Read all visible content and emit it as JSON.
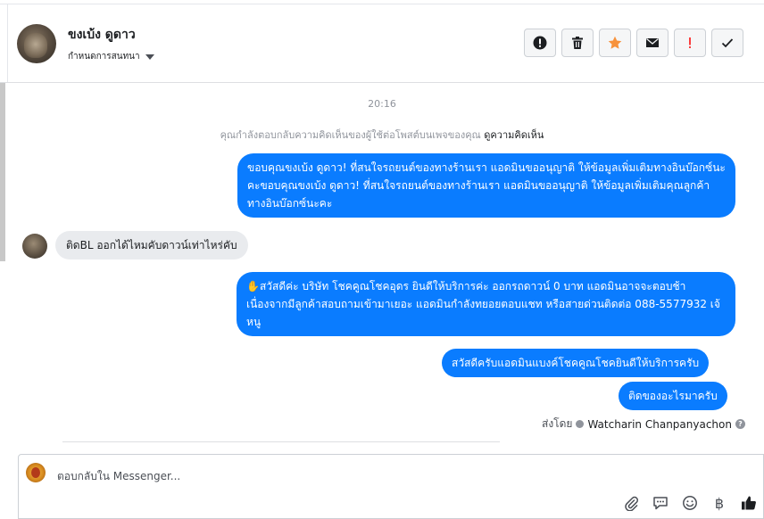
{
  "header": {
    "contact_name": "ขงเบ้ง ดูดาว",
    "assign_label": "กำหนดการสนทนา",
    "actions": [
      {
        "name": "spam-button",
        "icon": "exclamation-circle-icon"
      },
      {
        "name": "delete-button",
        "icon": "trash-icon"
      },
      {
        "name": "star-button",
        "icon": "star-icon"
      },
      {
        "name": "mark-unread-button",
        "icon": "envelope-icon"
      },
      {
        "name": "follow-up-button",
        "icon": "exclamation-icon"
      },
      {
        "name": "done-button",
        "icon": "check-icon"
      }
    ],
    "colors": {
      "star": "#f7923b",
      "flag": "#fa3e3e"
    }
  },
  "conversation": {
    "timestamp": "20:16",
    "notice_text": "คุณกำลังตอบกลับความคิดเห็นของผู้ใช้ต่อโพสต์บนเพจของคุณ",
    "notice_link": "ดูความคิดเห็น",
    "messages": [
      {
        "direction": "out",
        "text": "ขอบคุณขงเบ้ง ดูดาว! ที่สนใจรถยนต์ของทางร้านเรา แอดมินขออนุญาติ ให้ข้อมูลเพิ่มเติมทางอินบ๊อกซ์นะคะขอบคุณขงเบ้ง ดูดาว! ที่สนใจรถยนต์ของทางร้านเรา แอดมินขออนุญาติ ให้ข้อมูลเพิ่มเติมคุณลูกค้า ทางอินบ๊อกซ์นะคะ"
      },
      {
        "direction": "in",
        "text": "ติดBL ออกได้ไหมคับดาวน์เท่าไหร่คับ"
      },
      {
        "direction": "out",
        "emoji": "✋",
        "text": "สวัสดีค่ะ บริษัท โชคคูณโชคอุดร ยินดีให้บริการค่ะ ออกรถดาวน์ 0 บาท แอดมินอาจจะตอบช้าเนื่องจากมีลูกค้าสอบถามเข้ามาเยอะ แอดมินกำลังทยอยตอบแชท หรือสายด่วนติดต่อ 088-5577932 เจ้หนู"
      },
      {
        "direction": "out",
        "text": "สวัสดีครับแอดมินแบงค์โชคคูณโชคยินดีให้บริการครับ"
      },
      {
        "direction": "out",
        "text": "ติดของอะไรมาครับ"
      }
    ],
    "sent_by_label": "ส่งโดย",
    "sent_by_name": "Watcharin Chanpanyachon",
    "colors": {
      "outgoing": "#0a7cff",
      "incoming": "#e9ebee"
    }
  },
  "composer": {
    "placeholder": "ตอบกลับใน Messenger...",
    "tools": [
      "paperclip-icon",
      "saved-reply-icon",
      "emoji-icon",
      "baht-icon",
      "thumbs-up-icon"
    ]
  }
}
